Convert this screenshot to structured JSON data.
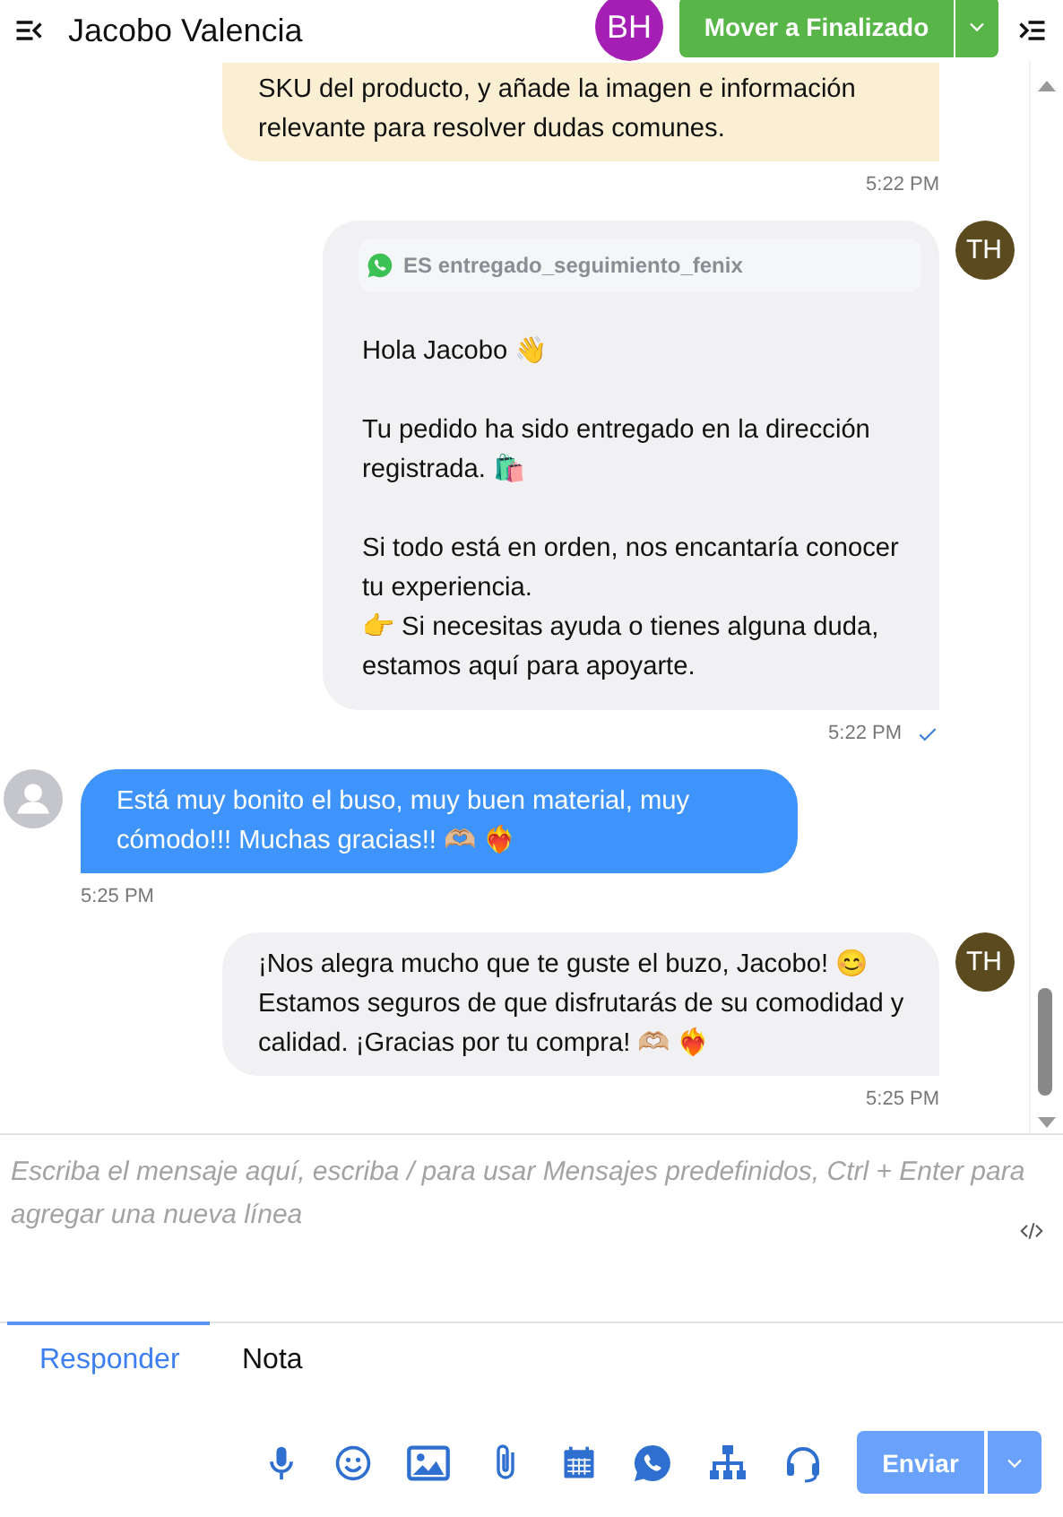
{
  "header": {
    "title": "Jacobo Valencia",
    "assignee": {
      "initials": "BH",
      "color": "#a51fb5"
    },
    "action_button": "Mover a Finalizado"
  },
  "messages": [
    {
      "kind": "note",
      "text": "SKU del producto, y añade la imagen e información relevante para resolver dudas comunes.",
      "time": "5:22 PM"
    },
    {
      "kind": "template",
      "template_name": "ES entregado_seguimiento_fenix",
      "text": "Hola Jacobo 👋\n\nTu pedido ha sido entregado en la dirección registrada. 🛍️\n\nSi todo está en orden, nos encantaría conocer tu experiencia.\n👉 Si necesitas ayuda o tienes alguna duda, estamos aquí para apoyarte.",
      "time": "5:22 PM",
      "delivered": true,
      "avatar": {
        "initials": "TH",
        "color": "#5b4a1e"
      }
    },
    {
      "kind": "customer",
      "text": "Está muy bonito el buso, muy buen material, muy cómodo!!! Muchas gracias!! 🫶🏼 ❤️‍🔥",
      "time": "5:25 PM"
    },
    {
      "kind": "agent",
      "text": "¡Nos alegra mucho que te guste el buzo, Jacobo! 😊 Estamos seguros de que disfrutarás de su comodidad y calidad. ¡Gracias por tu compra! 🫶🏼 ❤️‍🔥",
      "time": "5:25 PM",
      "avatar": {
        "initials": "TH",
        "color": "#5b4a1e"
      }
    }
  ],
  "composer": {
    "placeholder": "Escriba el mensaje aquí, escriba / para usar Mensajes predefinidos, Ctrl + Enter para agregar una nueva línea",
    "tabs": [
      {
        "label": "Responder",
        "selected": true
      },
      {
        "label": "Nota",
        "selected": false
      }
    ],
    "send_button": "Enviar"
  }
}
